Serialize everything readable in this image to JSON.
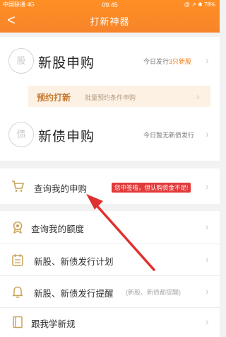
{
  "status_bar": {
    "carrier": "中国联通 4G",
    "time": "09:45",
    "right": "@ ↗ ✱ 78%"
  },
  "header": {
    "back": "<",
    "title": "打新神器"
  },
  "new_stock": {
    "icon_text": "股",
    "label": "新股申购",
    "note_prefix": "今日发行",
    "note_highlight": "3只新股"
  },
  "reserve": {
    "title": "预约打新",
    "subtitle": "批量预约条件申购"
  },
  "new_bond": {
    "icon_text": "债",
    "label": "新债申购",
    "note": "今日暂无新债发行"
  },
  "rows": {
    "my_subscription": "查询我的申购",
    "badge": "您中签啦，但认购资金不足!",
    "my_quota": "查询我的额度",
    "issue_plan": "新股、新债发行计划",
    "issue_reminder": "新股、新债发行提醒",
    "reminder_note": "(新股、新债都提醒)",
    "learn_rules": "跟我学新规"
  },
  "colors": {
    "header": "#f8842a",
    "accent": "#f07d1a",
    "badge": "#e23a3a",
    "arrow": "#e0302f"
  }
}
